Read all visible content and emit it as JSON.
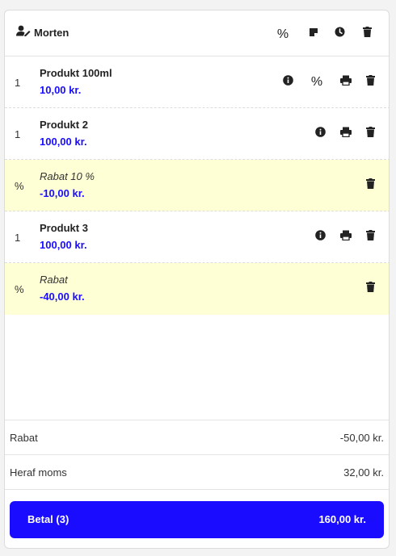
{
  "header": {
    "customer_name": "Morten",
    "discount_symbol": "%"
  },
  "lines": [
    {
      "qty": "1",
      "name": "Produkt 100ml",
      "price": "10,00 kr.",
      "is_discount": false
    },
    {
      "qty": "1",
      "name": "Produkt 2",
      "price": "100,00 kr.",
      "is_discount": false
    },
    {
      "qty": "%",
      "name": "Rabat 10 %",
      "price": "-10,00 kr.",
      "is_discount": true
    },
    {
      "qty": "1",
      "name": "Produkt 3",
      "price": "100,00 kr.",
      "is_discount": false
    },
    {
      "qty": "%",
      "name": "Rabat",
      "price": "-40,00 kr.",
      "is_discount": true
    }
  ],
  "line1_discount_symbol": "%",
  "summary": {
    "discount_label": "Rabat",
    "discount_value": "-50,00 kr.",
    "vat_label": "Heraf moms",
    "vat_value": "32,00 kr."
  },
  "pay": {
    "label": "Betal (3)",
    "total": "160,00 kr."
  },
  "colors": {
    "accent": "#1a0dff",
    "discount_bg": "#ffffd6"
  }
}
